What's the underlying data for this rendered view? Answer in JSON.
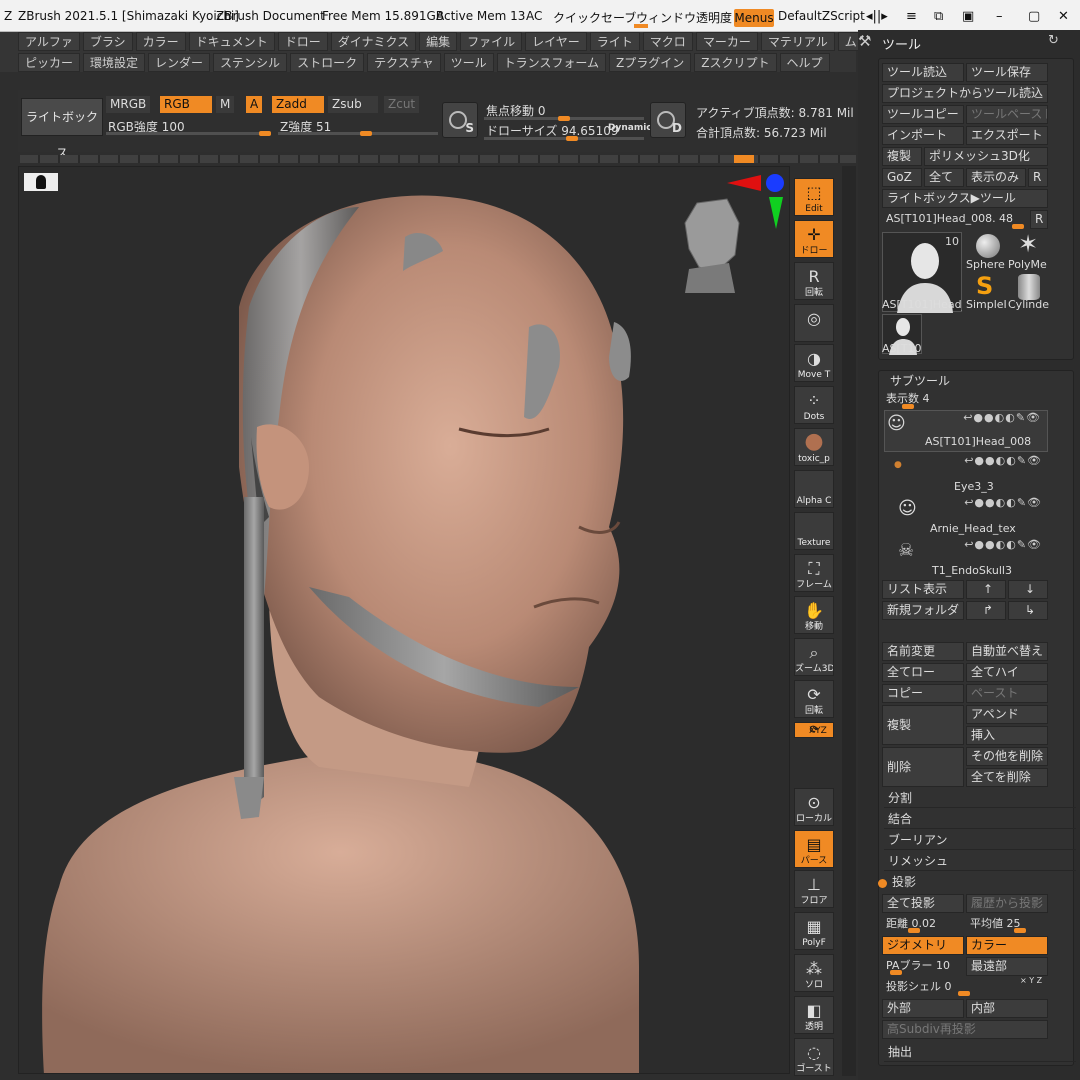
{
  "titlebar": {
    "app_title": "ZBrush 2021.5.1 [Shimazaki Kyoichi]",
    "document": "ZBrush Document",
    "free_mem": "Free Mem 15.891GB",
    "active_mem": "Active Mem 13",
    "ac": "AC",
    "quicksave": "クイックセーブ",
    "window_transparency": "ウィンドウ透明度",
    "menus": "Menus",
    "default_zscript": "DefaultZScript"
  },
  "menubar": {
    "row1": [
      "アルファ",
      "ブラシ",
      "カラー",
      "ドキュメント",
      "ドロー",
      "ダイナミクス",
      "編集",
      "ファイル",
      "レイヤー",
      "ライト",
      "マクロ",
      "マーカー",
      "マテリアル",
      "ムービー"
    ],
    "row2": [
      "ピッカー",
      "環境設定",
      "レンダー",
      "ステンシル",
      "ストローク",
      "テクスチャ",
      "ツール",
      "トランスフォーム",
      "Zプラグイン",
      "Zスクリプト",
      "ヘルプ"
    ]
  },
  "toolbar": {
    "lightbox": "ライトボックス",
    "mrgb": "MRGB",
    "rgb": "RGB",
    "m": "M",
    "a": "A",
    "zadd": "Zadd",
    "zsub": "Zsub",
    "zcut": "Zcut",
    "rgb_intensity_label": "RGB強度 100",
    "rgb_intensity": 1.0,
    "z_intensity_label": "Z強度 51",
    "z_intensity": 0.51,
    "focal_label": "焦点移動 0",
    "draw_size_label": "ドローサイズ 94.65109",
    "dynamic": "Dynamic",
    "s_label": "S",
    "d_label": "D",
    "active_points": "アクティブ頂点数: 8.781 Mil",
    "total_points": "合計頂点数: 56.723 Mil"
  },
  "palette": [
    {
      "label": "Edit",
      "icon": "edit-icon",
      "on": true
    },
    {
      "label": "ドロー",
      "icon": "draw-icon",
      "on": true
    },
    {
      "label": "回転",
      "icon": "rotate-r-icon",
      "on": false
    },
    {
      "label": "",
      "icon": "brush-material-icon",
      "on": false
    },
    {
      "label": "Move T",
      "icon": "move-brush-icon",
      "on": false
    },
    {
      "label": "Dots",
      "icon": "dots-stroke-icon",
      "on": false
    },
    {
      "label": "toxic_p",
      "icon": "material-sphere-icon",
      "on": false
    },
    {
      "label": "Alpha C",
      "icon": "alpha-icon",
      "on": false
    },
    {
      "label": "Texture",
      "icon": "texture-icon",
      "on": false
    },
    {
      "label": "フレーム",
      "icon": "frame-icon",
      "on": false
    },
    {
      "label": "移動",
      "icon": "move-hand-icon",
      "on": false
    },
    {
      "label": "ズーム3D",
      "icon": "zoom3d-icon",
      "on": false
    },
    {
      "label": "回転",
      "icon": "rotate-icon",
      "on": false
    },
    {
      "label": "XYZ",
      "icon": "xyz-icon",
      "on": true
    },
    {
      "label": "ローカル",
      "icon": "local-icon",
      "on": false
    },
    {
      "label": "パース",
      "icon": "perspective-icon",
      "on": true
    },
    {
      "label": "フロア",
      "icon": "floor-icon",
      "on": false
    },
    {
      "label": "PolyF",
      "icon": "polyframe-icon",
      "on": false
    },
    {
      "label": "ソロ",
      "icon": "solo-icon",
      "on": false
    },
    {
      "label": "透明",
      "icon": "transparent-icon",
      "on": false
    },
    {
      "label": "ゴースト",
      "icon": "ghost-icon",
      "on": false
    }
  ],
  "rpanel": {
    "title": "ツール",
    "load_tool": "ツール読込",
    "save_tool": "ツール保存",
    "load_from_project": "プロジェクトからツール読込",
    "copy_tool": "ツールコピー",
    "paste_tool": "ツールペースト",
    "import": "インポート",
    "export": "エクスポート",
    "clone": "複製",
    "polymesh3d": "ポリメッシュ3D化",
    "goz": "GoZ",
    "all": "全て",
    "visible": "表示のみ",
    "r": "R",
    "lightbox_tools": "ライトボックス▶ツール",
    "current_tool": "AS[T101]Head_008. 48",
    "thumb_count": "10",
    "tools": [
      "AS[T101]Head_",
      "Sphere",
      "PolyMe",
      "SimpleI",
      "Cylinde",
      "AS[T10"
    ],
    "subtool_title": "サブツール",
    "display_count": "表示数 4",
    "subtools": [
      "AS[T101]Head_008",
      "Eye3_3",
      "Arnie_Head_tex",
      "T1_EndoSkull3"
    ],
    "list_all": "リスト表示",
    "new_folder": "新規フォルダ",
    "rename": "名前変更",
    "autoreorder": "自動並べ替え",
    "all_low": "全てロー",
    "all_high": "全てハイ",
    "copy": "コピー",
    "paste": "ペースト",
    "duplicate": "複製",
    "append": "アペンド",
    "insert": "挿入",
    "delete": "削除",
    "del_other": "その他を削除",
    "del_all": "全てを削除",
    "split": "分割",
    "merge": "結合",
    "boolean": "ブーリアン",
    "remesh": "リメッシュ",
    "project": "投影",
    "project_all": "全て投影",
    "project_history": "履歴から投影",
    "distance": "距離 0.02",
    "mean": "平均値 25",
    "geometry": "ジオメトリ",
    "color": "カラー",
    "pablur": "PAブラー 10",
    "farthest": "最遠部",
    "project_shell": "投影シェル 0",
    "outer": "外部",
    "inner": "内部",
    "reproject_subdiv": "高Subdiv再投影",
    "extract": "抽出"
  }
}
